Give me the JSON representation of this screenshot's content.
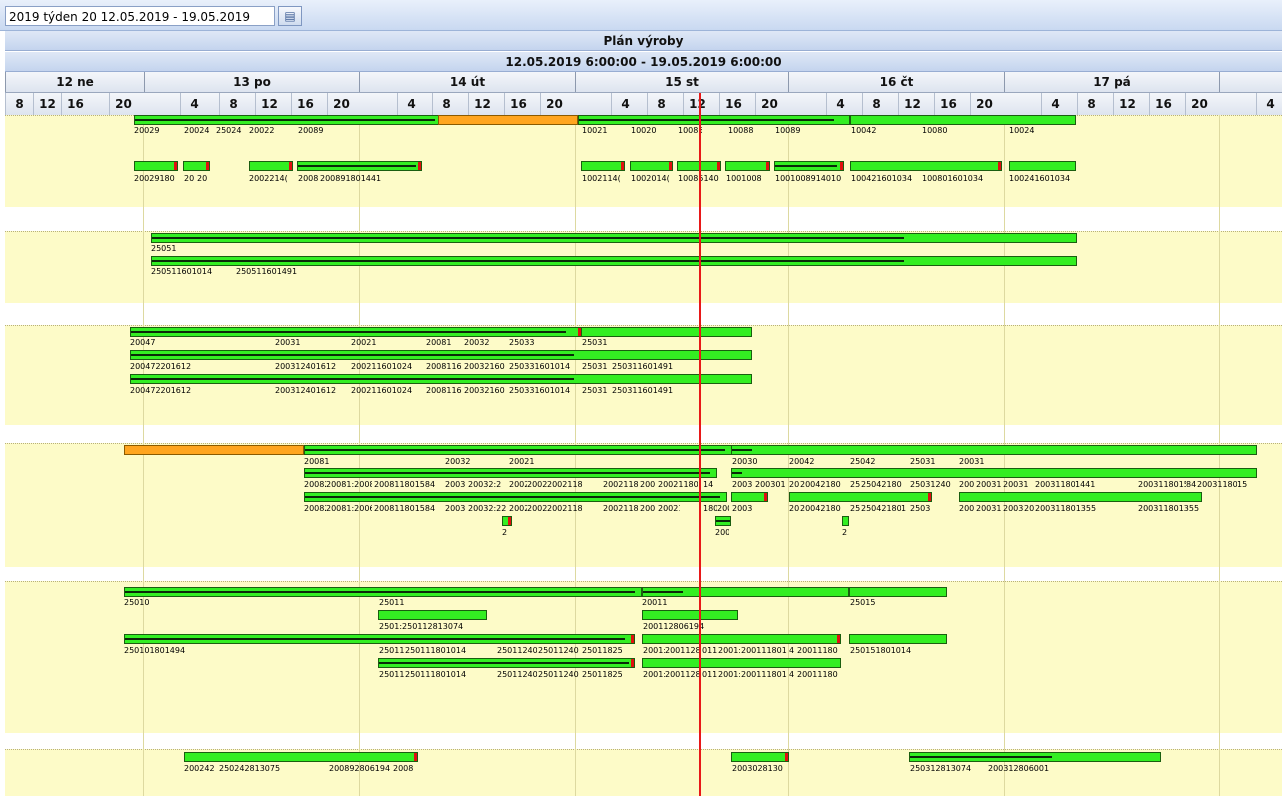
{
  "toolbar": {
    "week_value": "2019 týden 20 12.05.2019 - 19.05.2019",
    "calendar_icon": "calendar-icon"
  },
  "header": {
    "title": "Plán výroby",
    "range": "12.05.2019 6:00:00 - 19.05.2019 6:00:00"
  },
  "timeline": {
    "days": [
      "12 ne",
      "13 po",
      "14 út",
      "15 st",
      "16 čt",
      "17 pá"
    ],
    "hours": [
      "8",
      "12",
      "16",
      "20",
      "4",
      "8",
      "12",
      "16",
      "20",
      "4",
      "8",
      "12",
      "16",
      "20",
      "4",
      "8",
      "12",
      "16",
      "20",
      "4",
      "8",
      "12",
      "16",
      "20",
      "4",
      "8",
      "12",
      "16",
      "20",
      "4"
    ]
  },
  "schedule": {
    "section1": {
      "row1": [
        "20029",
        "20024",
        "25024",
        "20022",
        "20089",
        "10021",
        "10020",
        "10085",
        "10088",
        "10089",
        "10042",
        "10080",
        "10024"
      ],
      "row2": [
        "20029180",
        "20",
        "20",
        "2002214(",
        "2008",
        "200891801441",
        "1002114(",
        "1002014(",
        "10085140",
        "1001008",
        "1001008914010",
        "100421601034",
        "100801601034",
        "100241601034"
      ]
    },
    "section2": {
      "row1": [
        "25051"
      ],
      "row2": [
        "250511601014",
        "250511601491"
      ]
    },
    "section3": {
      "row1": [
        "20047",
        "20031",
        "20021",
        "20081",
        "20032",
        "25033",
        "25031"
      ],
      "row2": [
        "200472201612",
        "200312401612",
        "200211601024",
        "2008116",
        "20032160",
        "250331601014",
        "25031",
        "250311601491"
      ],
      "row3": [
        "200472201612",
        "200312401612",
        "200211601024",
        "2008116",
        "20032160",
        "250331601014",
        "25031",
        "250311601491"
      ]
    },
    "section4": {
      "row1": [
        "20081",
        "20032",
        "20021",
        "20030",
        "20042",
        "25042",
        "25031",
        "20031"
      ],
      "row2": [
        "20082",
        "20081:2008",
        "200811801584",
        "2003",
        "20032:2",
        "2002",
        "2002",
        "20021180",
        "20021180",
        "200",
        "20021180",
        "14",
        "2003",
        "200301",
        "20",
        "20042180",
        "25",
        "25042180",
        "25031240",
        "200",
        "20031",
        "20031",
        "20031180",
        "1441",
        "2003118015",
        "84",
        "20031180",
        "15"
      ],
      "row3": [
        "20082",
        "20081:2006",
        "200811801584",
        "2003",
        "20032:22",
        "2002",
        "2002",
        "20021180",
        "20021180",
        "200",
        "20021",
        "180",
        "200",
        "2003",
        "20",
        "20042180",
        "25",
        "25042180",
        "1",
        "2503",
        "200",
        "20031",
        "2003",
        "20",
        "200311801355",
        "200311801355"
      ],
      "row4": [
        "2",
        "200",
        "2"
      ]
    },
    "section5": {
      "row1": [
        "25010",
        "25011",
        "20011",
        "25015"
      ],
      "row2": [
        "2501:250112813074",
        "200112806194"
      ],
      "row3": [
        "250101801494",
        "25011",
        "250111801014",
        "25011240",
        "25011240",
        "25011825",
        "2001:",
        "20011280",
        "011",
        "2001:",
        "200111801",
        "4",
        "20011180",
        "250151801014"
      ],
      "row4": [
        "25011",
        "250111801014",
        "25011240",
        "25011240",
        "25011825",
        "2001:",
        "20011280",
        "011",
        "2001:",
        "200111801",
        "4",
        "20011180"
      ]
    },
    "section6": {
      "row1": [
        "200242",
        "250242813075",
        "200892806194",
        "2008",
        "2003028130",
        "250312813074",
        "200312806001"
      ]
    }
  },
  "colors": {
    "bar_green": "#33ee22",
    "bar_orange": "#ffa51f",
    "grid_bg": "#fdfbc8",
    "now_line": "#e81818"
  }
}
